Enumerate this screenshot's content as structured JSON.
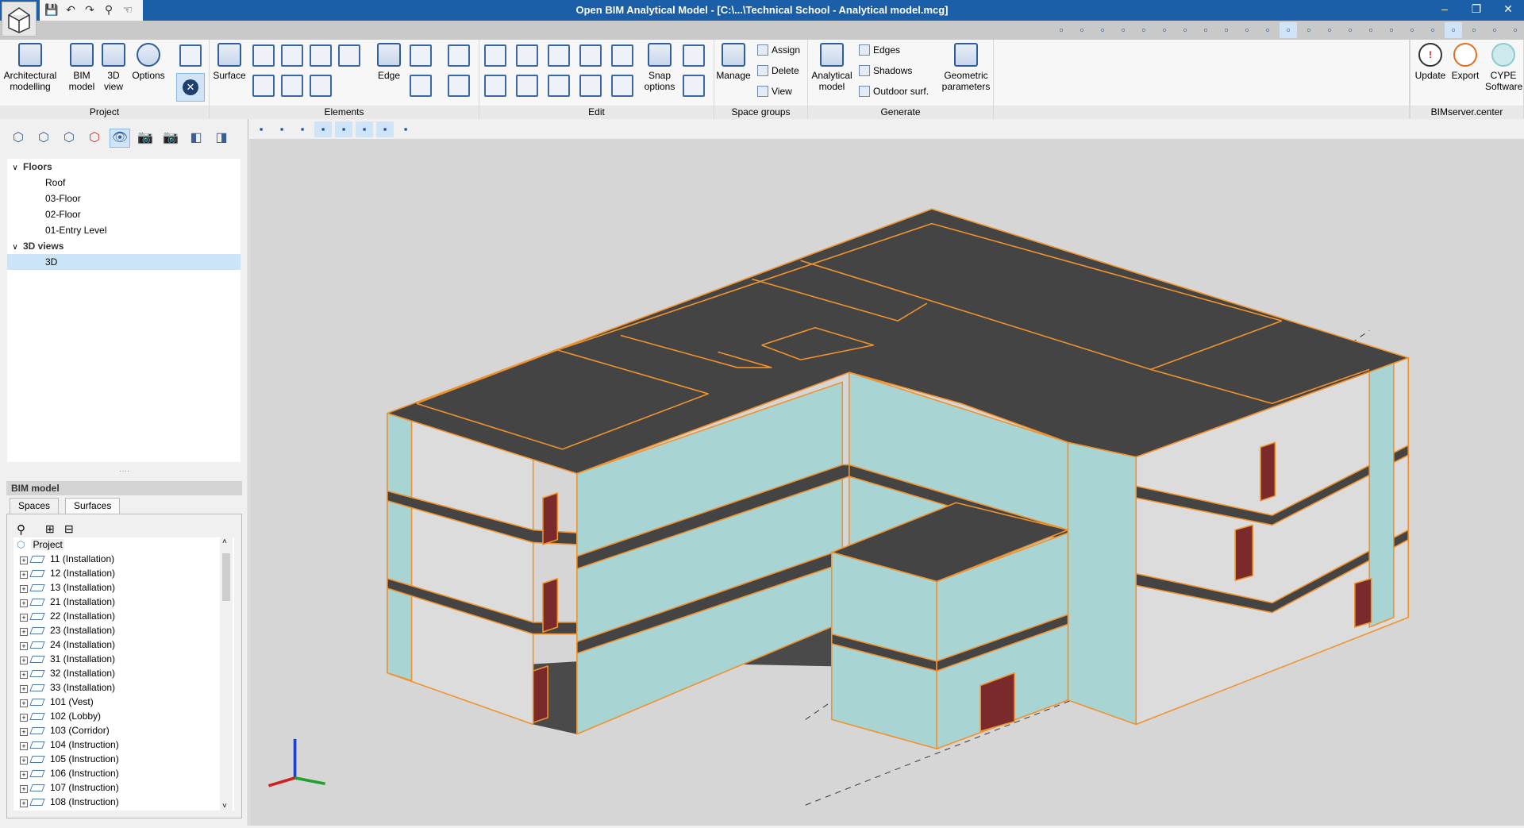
{
  "window": {
    "title": "Open BIM Analytical Model - [C:\\...\\Technical School - Analytical model.mcg]",
    "minimize": "–",
    "restore": "❐",
    "close": "✕"
  },
  "quick_access": [
    {
      "icon": "save-icon",
      "glyph": "💾"
    },
    {
      "icon": "undo-icon",
      "glyph": "↶"
    },
    {
      "icon": "redo-icon",
      "glyph": "↷"
    },
    {
      "icon": "search-icon",
      "glyph": "⚲"
    },
    {
      "icon": "select-icon",
      "glyph": "☜"
    }
  ],
  "ribbon": {
    "groups": {
      "project": "Project",
      "elements": "Elements",
      "edit": "Edit",
      "space_groups": "Space groups",
      "generate": "Generate",
      "bimserver": "BIMserver.center"
    },
    "architectural_modelling": "Architectural modelling",
    "bim_model": "BIM model",
    "view3d": "3D view",
    "options": "Options",
    "surface": "Surface",
    "edge": "Edge",
    "snap_options": "Snap options",
    "manage": "Manage",
    "assign": "Assign",
    "delete": "Delete",
    "view": "View",
    "analytical_model": "Analytical model",
    "edges": "Edges",
    "shadows": "Shadows",
    "outdoor_surf": "Outdoor surf.",
    "geometric_parameters": "Geometric parameters",
    "update": "Update",
    "export": "Export",
    "cype_software": "CYPE Software"
  },
  "tree": {
    "floors_label": "Floors",
    "floors": [
      "Roof",
      "03-Floor",
      "02-Floor",
      "01-Entry Level"
    ],
    "views_label": "3D views",
    "views": [
      "3D"
    ],
    "selected": "3D"
  },
  "bim_model": {
    "header": "BIM model",
    "tabs": [
      "Spaces",
      "Surfaces"
    ],
    "active_tab": "Spaces",
    "root": "Project",
    "spaces": [
      "11 (Installation)",
      "12 (Installation)",
      "13 (Installation)",
      "21 (Installation)",
      "22 (Installation)",
      "23 (Installation)",
      "24 (Installation)",
      "31 (Installation)",
      "32 (Installation)",
      "33 (Installation)",
      "101 (Vest)",
      "102 (Lobby)",
      "103 (Corridor)",
      "104 (Instruction)",
      "105 (Instruction)",
      "106 (Instruction)",
      "107 (Instruction)",
      "108 (Instruction)"
    ]
  },
  "colors": {
    "title_bar": "#1b5fa8",
    "slab": "#444444",
    "wall_glass": "#a8d4d4",
    "wall_interior": "#dcdcdc",
    "edge": "#f0922e",
    "door": "#7a2a2a",
    "viewport_bg": "#d6d6d6"
  }
}
